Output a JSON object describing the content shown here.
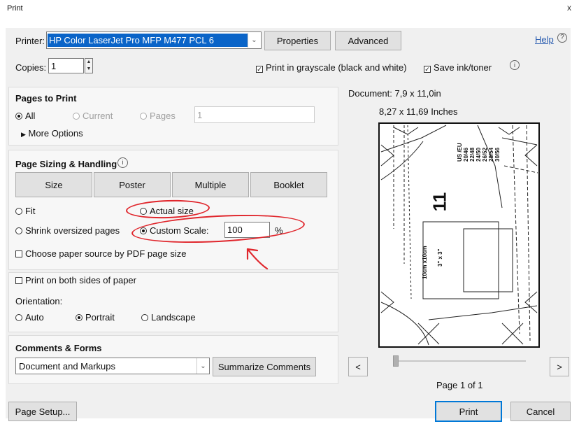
{
  "window": {
    "title": "Print",
    "close": "x"
  },
  "printer": {
    "label": "Printer:",
    "selected": "HP Color LaserJet Pro MFP M477 PCL 6",
    "properties_label": "Properties",
    "advanced_label": "Advanced",
    "help_label": "Help"
  },
  "copies": {
    "label": "Copies:",
    "value": "1"
  },
  "options": {
    "grayscale_label": "Print in grayscale (black and white)",
    "grayscale_checked": true,
    "save_ink_label": "Save ink/toner",
    "save_ink_checked": true
  },
  "pages_to_print": {
    "title": "Pages to Print",
    "all_label": "All",
    "current_label": "Current",
    "pages_label": "Pages",
    "pages_value": "1",
    "more_options_label": "More Options"
  },
  "page_sizing": {
    "title": "Page Sizing & Handling",
    "tabs": [
      "Size",
      "Poster",
      "Multiple",
      "Booklet"
    ],
    "fit_label": "Fit",
    "actual_size_label": "Actual size",
    "shrink_label": "Shrink oversized pages",
    "custom_scale_label": "Custom Scale:",
    "custom_scale_value": "100",
    "percent": "%",
    "paper_source_label": "Choose paper source by PDF page size"
  },
  "duplex": {
    "label": "Print on both sides of paper"
  },
  "orientation": {
    "label": "Orientation:",
    "auto_label": "Auto",
    "portrait_label": "Portrait",
    "landscape_label": "Landscape"
  },
  "comments": {
    "title": "Comments & Forms",
    "selected": "Document and Markups",
    "summarize_label": "Summarize Comments"
  },
  "preview": {
    "document_size": "Document: 7,9 x 11,0in",
    "paper_size": "8,27 x 11,69 Inches",
    "page_indicator": "Page 1 of 1",
    "prev": "<",
    "next": ">",
    "sheet_number": "11",
    "size_list": [
      "US /EU",
      "20/46",
      "22/48",
      "24/50",
      "26/52",
      "28/54",
      "30/56"
    ],
    "box_label_1": "10cm x10cm",
    "box_label_2": "3\" x 3\""
  },
  "footer": {
    "page_setup_label": "Page Setup...",
    "print_label": "Print",
    "cancel_label": "Cancel"
  },
  "colors": {
    "accent": "#0078d7",
    "annotation": "#e0262c",
    "selection": "#0a64c8"
  }
}
